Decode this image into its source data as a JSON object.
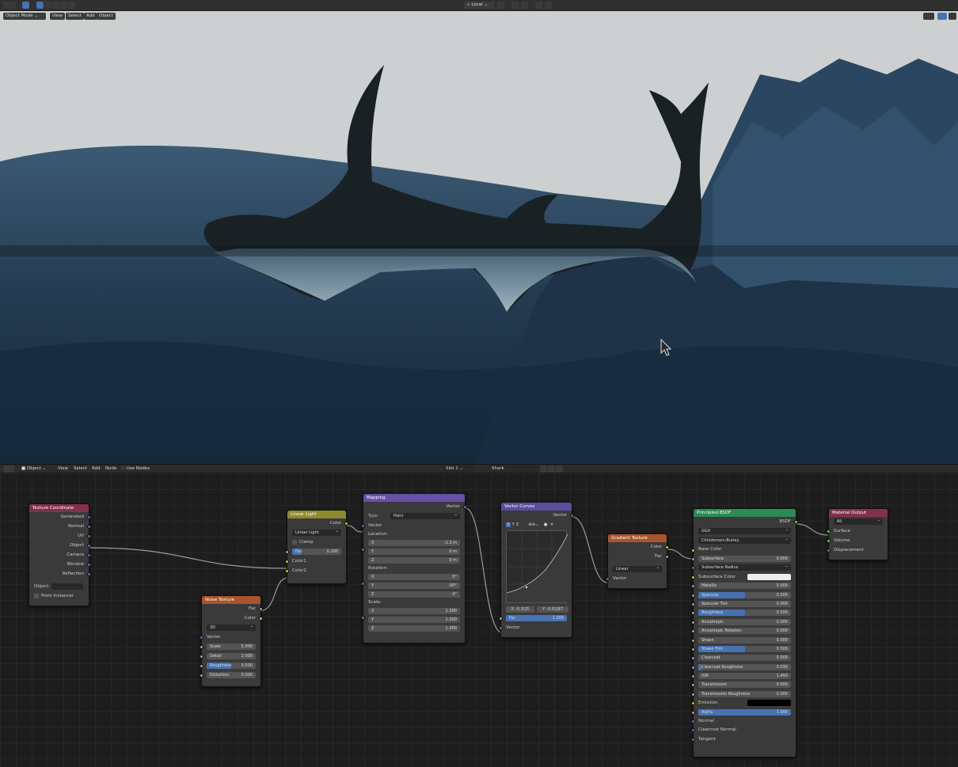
{
  "topbar": {
    "mode": "Object Mode",
    "menus": [
      "View",
      "Select",
      "Add",
      "Object"
    ],
    "orientation": "Local"
  },
  "editor": {
    "type": "Object",
    "menus": [
      "View",
      "Select",
      "Add",
      "Node"
    ],
    "use_nodes": "Use Nodes",
    "slot": "Slot 1",
    "material": "Shark"
  },
  "colors": {
    "accent": "#4772b3",
    "socket_color": "#c7c729",
    "socket_vector": "#6363c7",
    "socket_float": "#a1a1a1",
    "socket_shader": "#63c763"
  },
  "nodes": {
    "texcoord": {
      "title": "Texture Coordinate",
      "outputs": [
        "Generated",
        "Normal",
        "UV",
        "Object",
        "Camera",
        "Window",
        "Reflection"
      ],
      "object_label": "Object:",
      "from_instancer": "From Instancer"
    },
    "noise": {
      "title": "Noise Texture",
      "outputs": [
        "Fac",
        "Color"
      ],
      "dim": "3D",
      "vector": "Vector",
      "fields": [
        {
          "label": "Scale",
          "value": "5.000"
        },
        {
          "label": "Detail",
          "value": "2.000"
        },
        {
          "label": "Roughness",
          "value": "0.500"
        },
        {
          "label": "Distortion",
          "value": "0.000"
        }
      ]
    },
    "linear": {
      "title": "Linear Light",
      "output": "Color",
      "blend": "Linear Light",
      "clamp": "Clamp",
      "fac_label": "Fac",
      "fac_value": "0.200",
      "fac_fraction": 0.2,
      "inputs": [
        "Color1",
        "Color2"
      ]
    },
    "mapping": {
      "title": "Mapping",
      "output": "Vector",
      "type_label": "Type:",
      "type": "Point",
      "vector": "Vector",
      "location": "Location:",
      "rotation": "Rotation:",
      "scale": "Scale:",
      "loc": [
        {
          "a": "X",
          "v": "-1.3 m"
        },
        {
          "a": "Y",
          "v": "0 m"
        },
        {
          "a": "Z",
          "v": "0 m"
        }
      ],
      "rot": [
        {
          "a": "X",
          "v": "0°"
        },
        {
          "a": "Y",
          "v": "-90°"
        },
        {
          "a": "Z",
          "v": "0°"
        }
      ],
      "scl": [
        {
          "a": "X",
          "v": "1.000"
        },
        {
          "a": "Y",
          "v": "1.000"
        },
        {
          "a": "Z",
          "v": "1.000"
        }
      ]
    },
    "curves": {
      "title": "Vector Curves",
      "output": "Vector",
      "axes": [
        "X",
        "Y",
        "Z"
      ],
      "x_readout": "X -0.525",
      "y_readout": "Y -0.6187",
      "fac_label": "Fac",
      "fac_value": "1.000",
      "input": "Vector"
    },
    "gradient": {
      "title": "Gradient Texture",
      "outputs": [
        "Color",
        "Fac"
      ],
      "type": "Linear",
      "input": "Vector"
    },
    "bsdf": {
      "title": "Principled BSDF",
      "output": "BSDF",
      "dist": "GGX",
      "sss": "Christensen-Burley",
      "base": "Base Color",
      "rows": [
        {
          "label": "Subsurface",
          "value": "0.000",
          "fill": 0
        },
        {
          "label": "Subsurface Radius",
          "value": "",
          "fill": 0
        },
        {
          "label": "Subsurface Color",
          "value": "",
          "fill": 0
        },
        {
          "label": "Metallic",
          "value": "0.000",
          "fill": 0
        },
        {
          "label": "Specular",
          "value": "0.500",
          "fill": 0.5
        },
        {
          "label": "Specular Tint",
          "value": "0.000",
          "fill": 0
        },
        {
          "label": "Roughness",
          "value": "0.500",
          "fill": 0.5
        },
        {
          "label": "Anisotropic",
          "value": "0.000",
          "fill": 0
        },
        {
          "label": "Anisotropic Rotation",
          "value": "0.000",
          "fill": 0
        },
        {
          "label": "Sheen",
          "value": "0.000",
          "fill": 0
        },
        {
          "label": "Sheen Tint",
          "value": "0.500",
          "fill": 0.5
        },
        {
          "label": "Clearcoat",
          "value": "0.000",
          "fill": 0
        },
        {
          "label": "Clearcoat Roughness",
          "value": "0.030",
          "fill": 0.03
        },
        {
          "label": "IOR",
          "value": "1.450",
          "fill": 0
        },
        {
          "label": "Transmission",
          "value": "0.000",
          "fill": 0
        },
        {
          "label": "Transmission Roughness",
          "value": "0.000",
          "fill": 0
        },
        {
          "label": "Emission",
          "value": "",
          "fill": 0
        },
        {
          "label": "Alpha",
          "value": "1.000",
          "fill": 1
        }
      ],
      "tail": [
        "Normal",
        "Clearcoat Normal",
        "Tangent"
      ]
    },
    "output": {
      "title": "Material Output",
      "target": "All",
      "inputs": [
        "Surface",
        "Volume",
        "Displacement"
      ]
    }
  }
}
